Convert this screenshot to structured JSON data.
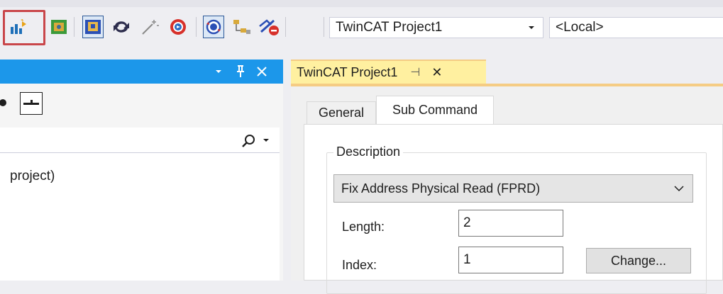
{
  "toolbar": {
    "project_combo": "TwinCAT Project1",
    "target_combo": "<Local>"
  },
  "left_panel": {
    "tree_item": "project)"
  },
  "document_tab": {
    "title": "TwinCAT Project1",
    "pin_glyph": "⊣",
    "close_glyph": "✕"
  },
  "tabs": [
    {
      "label": "General"
    },
    {
      "label": "Sub Command"
    }
  ],
  "description": {
    "group_label": "Description",
    "selected_command": "Fix Address Physical Read (FPRD)",
    "length_label": "Length:",
    "length_value": "2",
    "index_label": "Index:",
    "index_value": "1",
    "change_button": "Change..."
  }
}
